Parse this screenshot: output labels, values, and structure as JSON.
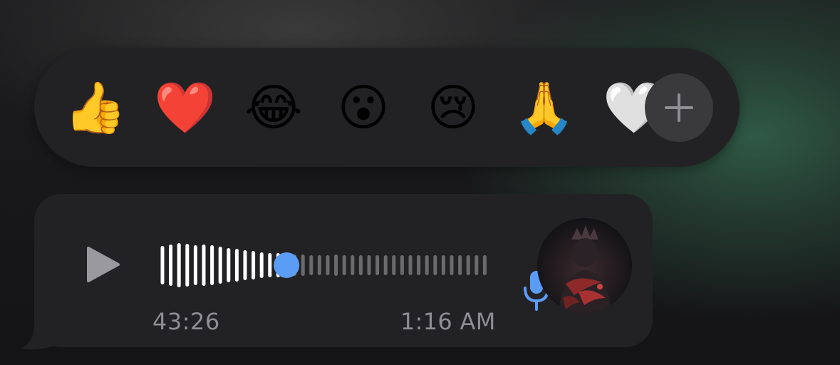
{
  "reactions": [
    {
      "name": "thumbs-up-emoji",
      "glyph": "👍"
    },
    {
      "name": "red-heart-emoji",
      "glyph": "❤️"
    },
    {
      "name": "tears-of-joy-emoji",
      "glyph": "😂"
    },
    {
      "name": "surprised-face-emoji",
      "glyph": "😮"
    },
    {
      "name": "crying-face-emoji",
      "glyph": "😢"
    },
    {
      "name": "folded-hands-emoji",
      "glyph": "🙏"
    },
    {
      "name": "white-heart-emoji",
      "glyph": "🤍"
    }
  ],
  "add_reaction_icon": "plus-icon",
  "voice_message": {
    "duration": "43:26",
    "timestamp": "1:16 AM",
    "playback_progress": 0.38,
    "play_icon": "play-icon",
    "mic_icon": "microphone-icon",
    "avatar": "sender-avatar"
  },
  "colors": {
    "accent_blue": "#5b9cf5",
    "played_bar": "#ffffff",
    "unplayed_bar": "#6b6b6e",
    "bubble": "#222224"
  }
}
